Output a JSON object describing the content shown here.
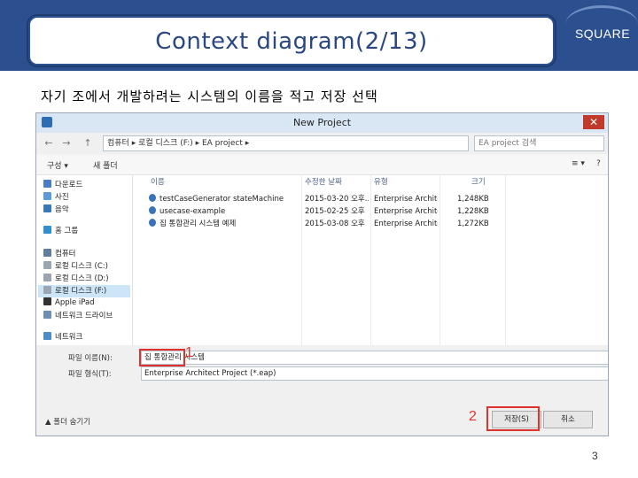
{
  "slide": {
    "title": "Context diagram(2/13)",
    "brand": "SQUARE",
    "subtitle": "자기 조에서 개발하려는 시스템의 이름을 적고 저장 선택",
    "page_number": "3",
    "theme_color": "#2b4f8f",
    "accent_color": "#e0322d"
  },
  "dialog": {
    "title": "New Project",
    "close_icon": "close-icon",
    "nav_back": "←",
    "nav_forward": "→",
    "nav_up": "↑",
    "address": "컴퓨터 ▸ 로컬 디스크 (F:) ▸ EA project ▸",
    "search_placeholder": "EA project 검색",
    "toolbar": {
      "organize": "구성 ▾",
      "new_folder": "새 폴더",
      "view_icon": "≡ ▾",
      "help_icon": "?"
    },
    "nav_items": [
      {
        "label": "다운로드",
        "icon": "download-icon"
      },
      {
        "label": "사진",
        "icon": "pictures-icon"
      },
      {
        "label": "음악",
        "icon": "music-icon"
      },
      {
        "label": "홈 그룹",
        "icon": "homegroup-icon"
      },
      {
        "label": "컴퓨터",
        "icon": "computer-icon"
      },
      {
        "label": "로컬 디스크 (C:)",
        "icon": "drive-icon"
      },
      {
        "label": "로컬 디스크 (D:)",
        "icon": "drive-icon"
      },
      {
        "label": "로컬 디스크 (F:)",
        "icon": "drive-icon"
      },
      {
        "label": "Apple iPad",
        "icon": "ipad-icon"
      },
      {
        "label": "네트워크 드라이브",
        "icon": "network-drive-icon"
      },
      {
        "label": "네트워크",
        "icon": "network-icon"
      }
    ],
    "columns": [
      "이름",
      "수정한 날짜",
      "유형",
      "크기"
    ],
    "files": [
      {
        "name": "testCaseGenerator stateMachine",
        "date": "2015-03-20 오후...",
        "type": "Enterprise Archite...",
        "size": "1,248KB"
      },
      {
        "name": "usecase-example",
        "date": "2015-02-25 오후",
        "type": "Enterprise Archite...",
        "size": "1,228KB"
      },
      {
        "name": "집 통합관리 시스템 예제",
        "date": "2015-03-08 오후",
        "type": "Enterprise Archite...",
        "size": "1,272KB"
      }
    ],
    "file_name_label": "파일 이름(N):",
    "file_name_value": "집 통합관리 시스템",
    "file_type_label": "파일 형식(T):",
    "file_type_value": "Enterprise Architect Project (*.eap)",
    "hide_folders": "폴더 숨기기",
    "save_button": "저장(S)",
    "cancel_button": "취소",
    "marker_1": "1",
    "marker_2": "2"
  }
}
